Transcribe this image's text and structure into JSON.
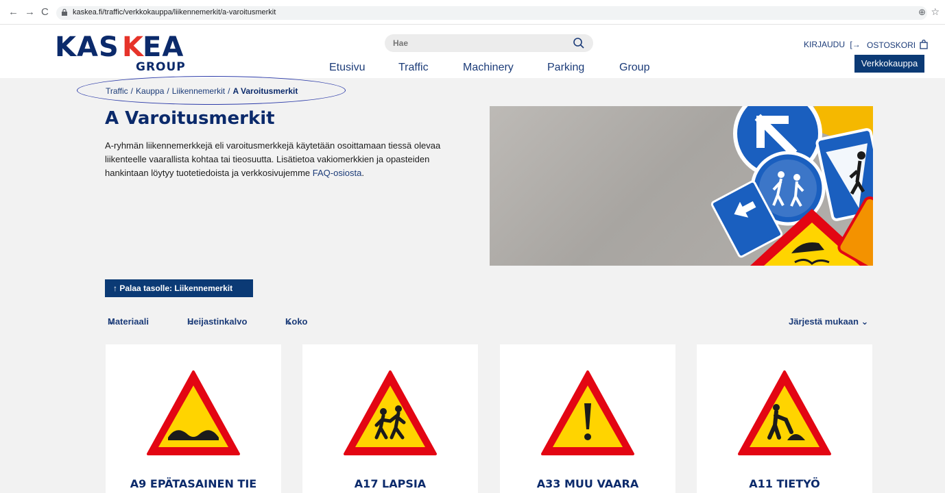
{
  "browser": {
    "url": "kaskea.fi/traffic/verkkokauppa/liikennemerkit/a-varoitusmerkit"
  },
  "header": {
    "logo_word": "KASKEA",
    "logo_group": "GROUP",
    "search_placeholder": "Hae",
    "nav": [
      "Etusivu",
      "Traffic",
      "Machinery",
      "Parking",
      "Group"
    ],
    "login_label": "KIRJAUDU",
    "cart_label": "OSTOSKORI",
    "shop_button": "Verkkokauppa"
  },
  "breadcrumb": {
    "items": [
      "Traffic",
      "Kauppa",
      "Liikennemerkit"
    ],
    "current": "A Varoitusmerkit"
  },
  "hero": {
    "title": "A Varoitusmerkit",
    "intro": "A-ryhmän liikennemerkkejä eli varoitusmerkkejä käytetään osoittamaan tiessä olevaa liikenteelle vaarallista kohtaa tai tieosuutta. Lisätietoa vakiomerkkien ja opasteiden hankintaan löytyy tuotetiedoista ja verkkosivujemme",
    "intro_link": "FAQ-osiosta",
    "intro_end": "."
  },
  "back_button": "Palaa tasolle: Liikennemerkit",
  "filters": [
    "Materiaali",
    "Heijastinkalvo",
    "Koko"
  ],
  "sort_label": "Järjestä mukaan",
  "products": [
    {
      "title": "A9 EPÄTASAINEN TIE",
      "icon": "uneven-road-sign"
    },
    {
      "title": "A17 LAPSIA",
      "icon": "children-sign"
    },
    {
      "title": "A33 MUU VAARA",
      "icon": "other-danger-sign"
    },
    {
      "title": "A11 TIETYÖ",
      "icon": "roadworks-sign"
    }
  ],
  "colors": {
    "brand_blue": "#0b2a6b",
    "button_blue": "#0b3a75",
    "sign_red": "#e30613",
    "sign_yellow": "#ffd400"
  }
}
